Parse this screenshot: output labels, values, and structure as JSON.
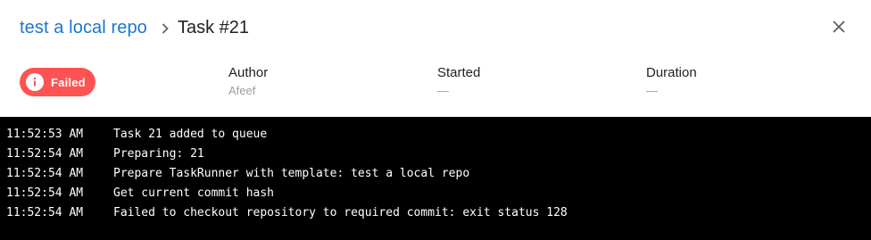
{
  "header": {
    "breadcrumb": "test a local repo",
    "title": "Task #21"
  },
  "status": {
    "label": "Failed",
    "color": "#ff5252",
    "icon": "info-icon"
  },
  "meta": {
    "author": {
      "label": "Author",
      "value": "Afeef"
    },
    "started": {
      "label": "Started",
      "value": "—"
    },
    "duration": {
      "label": "Duration",
      "value": "—"
    }
  },
  "log": [
    {
      "time": "11:52:53 AM",
      "message": "Task 21 added to queue"
    },
    {
      "time": "11:52:54 AM",
      "message": "Preparing: 21"
    },
    {
      "time": "11:52:54 AM",
      "message": "Prepare TaskRunner with template: test a local repo"
    },
    {
      "time": "11:52:54 AM",
      "message": "Get current commit hash"
    },
    {
      "time": "11:52:54 AM",
      "message": "Failed to checkout repository to required commit: exit status 128"
    }
  ],
  "colors": {
    "link": "#1976d2",
    "failed": "#ff5252",
    "console_bg": "#000000"
  }
}
